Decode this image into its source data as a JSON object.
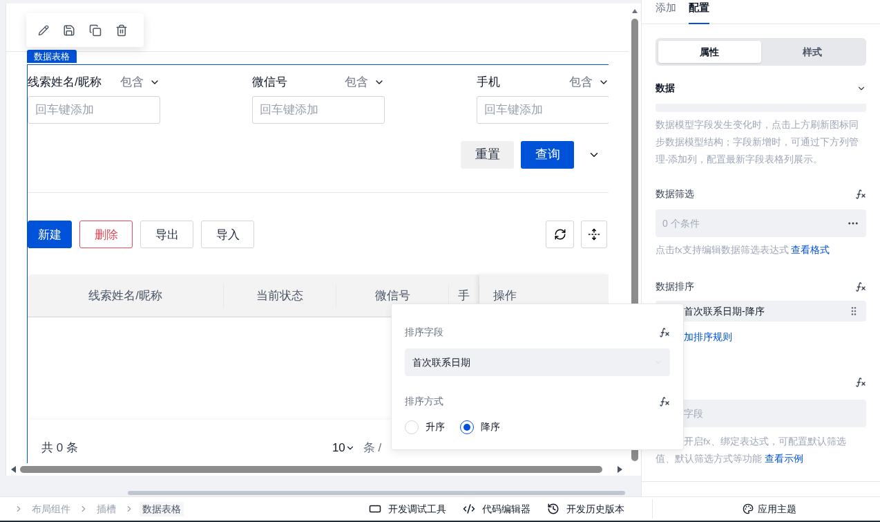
{
  "component_label": "数据表格",
  "filters": [
    {
      "label": "线索姓名/昵称",
      "operator": "包含",
      "placeholder": "回车键添加"
    },
    {
      "label": "微信号",
      "operator": "包含",
      "placeholder": "回车键添加"
    },
    {
      "label": "手机",
      "operator": "包含",
      "placeholder": "回车键添加"
    }
  ],
  "filter_buttons": [
    {
      "label": "重置",
      "kind": "default"
    },
    {
      "label": "查询",
      "kind": "primary"
    }
  ],
  "actions": [
    {
      "label": "新建",
      "kind": "primary"
    },
    {
      "label": "删除",
      "kind": "danger"
    },
    {
      "label": "导出",
      "kind": "default"
    },
    {
      "label": "导入",
      "kind": "default"
    }
  ],
  "table": {
    "columns": [
      "线索姓名/昵称",
      "当前状态",
      "微信号",
      "手"
    ],
    "fixed_column": "操作"
  },
  "pagination": {
    "total": "共 0 条",
    "page_size": "10",
    "unit": "条 /"
  },
  "sort_popover": {
    "field_label": "排序字段",
    "field_value": "首次联系日期",
    "order_label": "排序方式",
    "options": [
      {
        "label": "升序",
        "selected": false
      },
      {
        "label": "降序",
        "selected": true
      }
    ]
  },
  "panel": {
    "tabs": [
      {
        "label": "添加",
        "selected": false
      },
      {
        "label": "配置",
        "selected": true
      }
    ],
    "segments": [
      {
        "label": "属性",
        "selected": true
      },
      {
        "label": "样式",
        "selected": false
      }
    ],
    "data_title": "数据",
    "data_help": "数据模型字段发生变化时，点击上方刷新图标同步数据模型结构；字段新增时，可通过下方列管理-添加列，配置最新字段表格列展示。",
    "filter": {
      "title": "数据筛选",
      "value": "0 个条件",
      "help": "点击fx支持编辑数据筛选表达式",
      "link": "查看格式"
    },
    "sort": {
      "title": "数据排序",
      "items": [
        "首次联系日期-降序"
      ],
      "add_link": "加排序规则"
    },
    "filter_field": {
      "placeholder": "字段",
      "help_first": "开启fx、绑定表达式，可配置默认筛选",
      "help_second": "值、默认筛选方式等功能",
      "link": "查看示例"
    }
  },
  "breadcrumb": [
    "布局组件",
    "插槽",
    "数据表格"
  ],
  "bottom_tools": [
    {
      "label": "开发调试工具",
      "kind": "debug"
    },
    {
      "label": "代码编辑器",
      "kind": "code"
    },
    {
      "label": "开发历史版本",
      "kind": "history"
    }
  ],
  "theme_button": "应用主题"
}
